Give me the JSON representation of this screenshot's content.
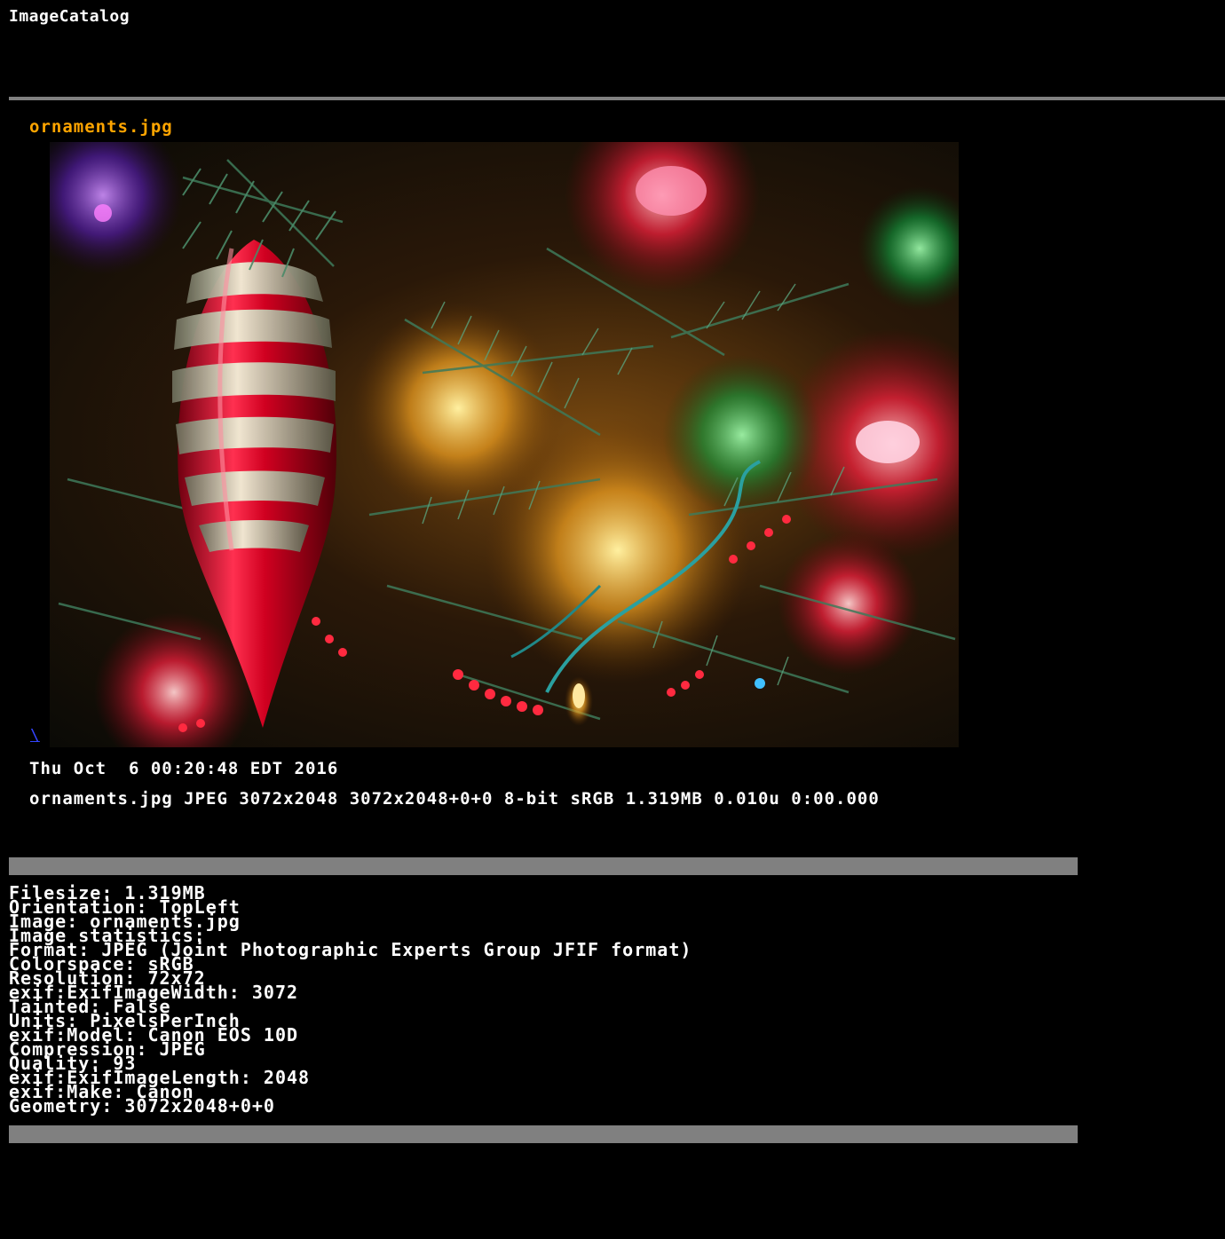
{
  "app": {
    "title": "ImageCatalog"
  },
  "image": {
    "filename": "ornaments.jpg",
    "link_mark": "\\",
    "alt": "ornaments.jpg"
  },
  "info": {
    "timestamp": "Thu Oct  6 00:20:48 EDT 2016",
    "summary": "ornaments.jpg JPEG 3072x2048 3072x2048+0+0 8-bit sRGB 1.319MB 0.010u 0:00.000"
  },
  "metadata": [
    "Filesize: 1.319MB",
    "Orientation: TopLeft",
    "Image: ornaments.jpg",
    "Image statistics:",
    "Format: JPEG (Joint Photographic Experts Group JFIF format)",
    "Colorspace: sRGB",
    "Resolution: 72x72",
    "exif:ExifImageWidth: 3072",
    "Tainted: False",
    "Units: PixelsPerInch",
    "exif:Model: Canon EOS 10D",
    "Compression: JPEG",
    "Quality: 93",
    "exif:ExifImageLength: 2048",
    "exif:Make: Canon",
    "Geometry: 3072x2048+0+0"
  ],
  "colors": {
    "background": "#000000",
    "text": "#ffffff",
    "filename_accent": "#ffa500",
    "rule": "#808080",
    "link": "#3344ff"
  }
}
